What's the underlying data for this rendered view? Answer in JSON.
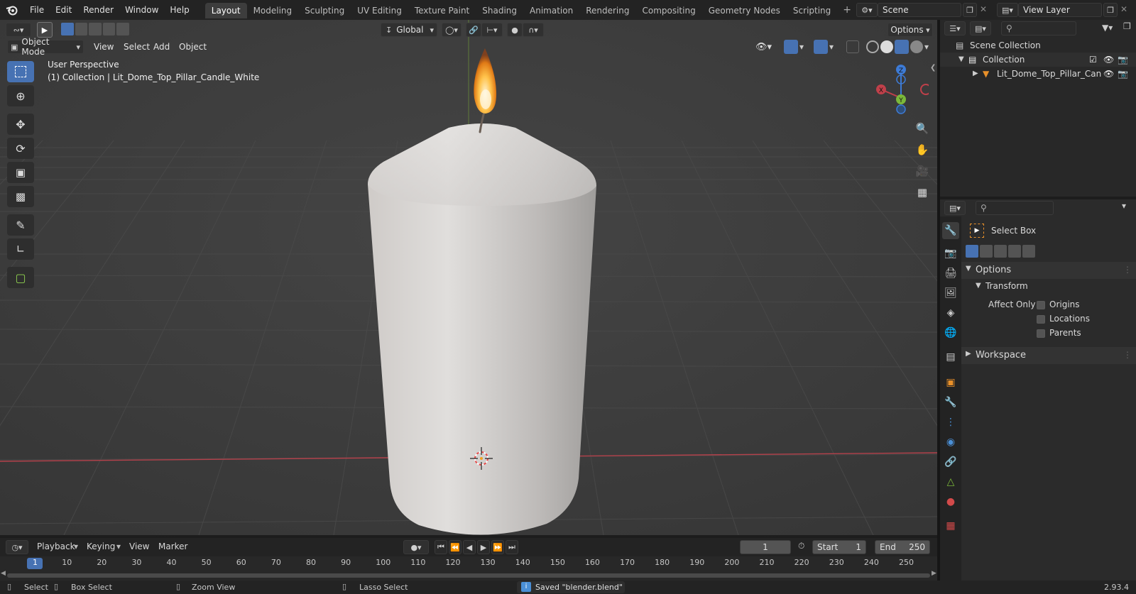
{
  "topbar": {
    "menus": [
      "File",
      "Edit",
      "Render",
      "Window",
      "Help"
    ],
    "workspaces": [
      "Layout",
      "Modeling",
      "Sculpting",
      "UV Editing",
      "Texture Paint",
      "Shading",
      "Animation",
      "Rendering",
      "Compositing",
      "Geometry Nodes",
      "Scripting"
    ],
    "active_workspace": "Layout",
    "scene_name": "Scene",
    "view_layer": "View Layer"
  },
  "viewport": {
    "mode": "Object Mode",
    "menus": [
      "View",
      "Select",
      "Add",
      "Object"
    ],
    "transform_orientation": "Global",
    "options_label": "Options",
    "overlay_title": "User Perspective",
    "overlay_subtitle": "(1) Collection | Lit_Dome_Top_Pillar_Candle_White",
    "gizmo_axes": {
      "x": "X",
      "y": "Y",
      "z": "Z"
    },
    "colors": {
      "background": "#3d3d3d",
      "x_axis": "#c0404a",
      "y_axis": "#7bb83a",
      "z_axis": "#3d7bd6",
      "active_tool": "#4772b3"
    }
  },
  "outliner": {
    "root": "Scene Collection",
    "collection": "Collection",
    "object": "Lit_Dome_Top_Pillar_Can"
  },
  "properties": {
    "tool_name": "Select Box",
    "options_label": "Options",
    "transform_label": "Transform",
    "affect_only_label": "Affect Only",
    "affect_only": [
      "Origins",
      "Locations",
      "Parents"
    ],
    "workspace_label": "Workspace"
  },
  "timeline": {
    "menus": [
      "Playback",
      "Keying",
      "View",
      "Marker"
    ],
    "current_frame": "1",
    "start_label": "Start",
    "start": "1",
    "end_label": "End",
    "end": "250",
    "ticks": [
      "1",
      "10",
      "20",
      "30",
      "40",
      "50",
      "60",
      "70",
      "80",
      "90",
      "100",
      "110",
      "120",
      "130",
      "140",
      "150",
      "160",
      "170",
      "180",
      "190",
      "200",
      "210",
      "220",
      "230",
      "240",
      "250"
    ]
  },
  "statusbar": {
    "select": "Select",
    "box_select": "Box Select",
    "zoom_view": "Zoom View",
    "lasso_select": "Lasso Select",
    "message": "Saved \"blender.blend\"",
    "version": "2.93.4"
  }
}
